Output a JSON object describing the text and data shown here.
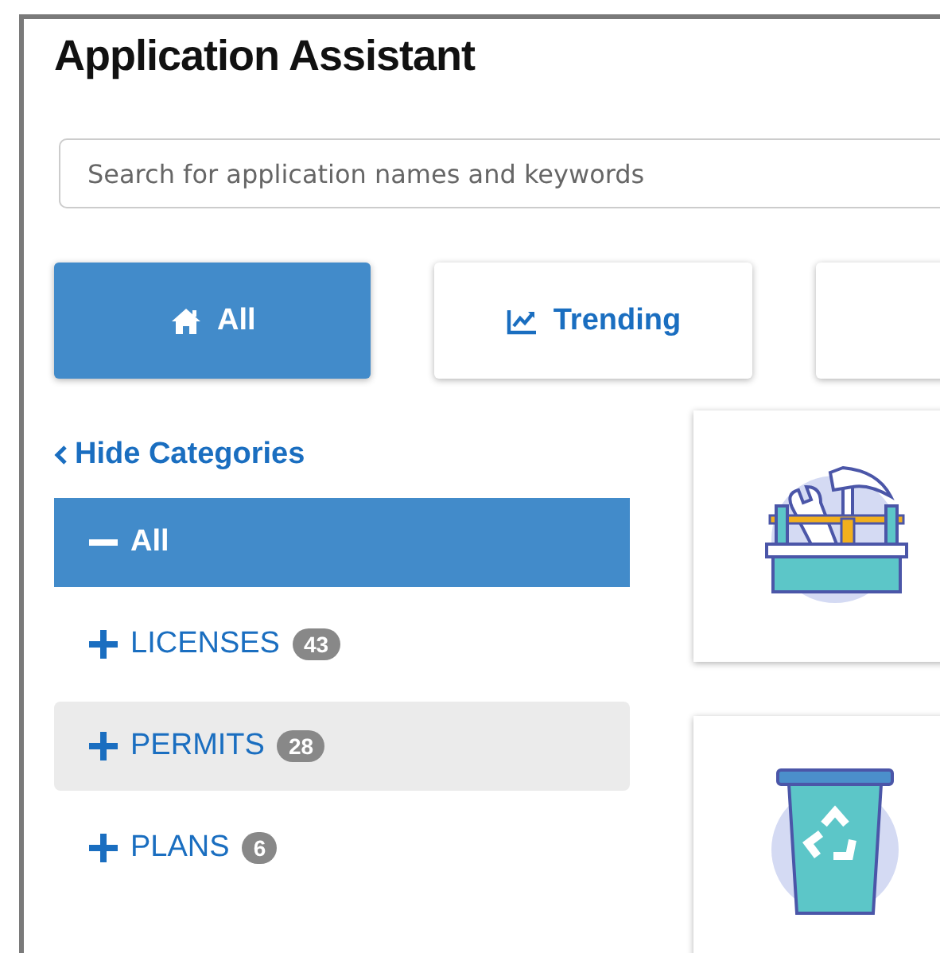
{
  "window": {
    "title": "Application Assistant"
  },
  "search": {
    "placeholder": "Search for application names and keywords"
  },
  "tabs": [
    {
      "label": "All",
      "kind": "home",
      "selected": true
    },
    {
      "label": "Trending",
      "kind": "chart",
      "selected": false
    },
    {
      "kind": "blank",
      "selected": false
    }
  ],
  "sidebar": {
    "toggle": "Hide Categories",
    "items": [
      {
        "label": "All",
        "expanded": true,
        "selected": true,
        "highlighted": false
      },
      {
        "label": "LICENSES",
        "count": "43",
        "expanded": false,
        "selected": false,
        "highlighted": false
      },
      {
        "label": "PERMITS",
        "count": "28",
        "expanded": false,
        "selected": false,
        "highlighted": true
      },
      {
        "label": "PLANS",
        "count": "6",
        "expanded": false,
        "selected": false,
        "highlighted": false
      }
    ]
  },
  "cards": [
    {
      "kind": "toolbox"
    },
    {
      "kind": "bin"
    }
  ]
}
